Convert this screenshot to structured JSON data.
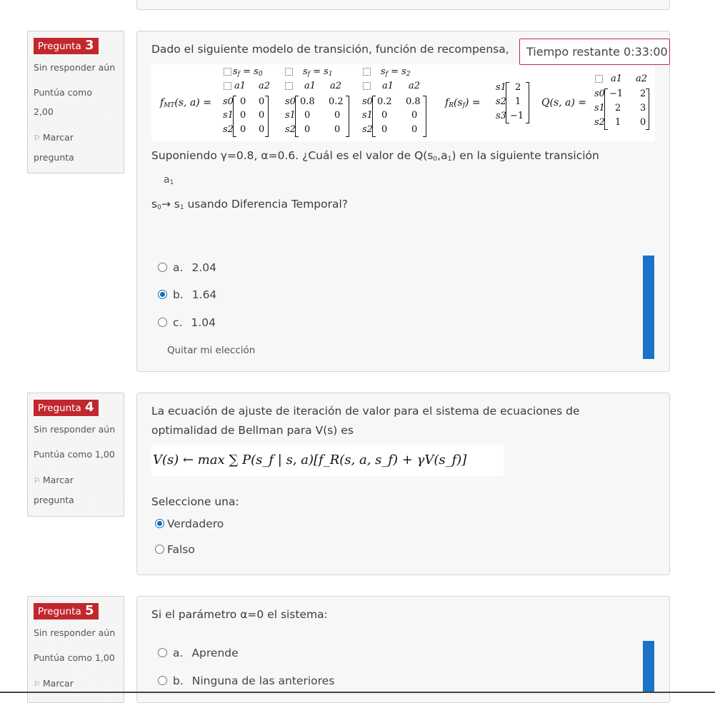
{
  "timer": {
    "label": "Tiempo restante 0:33:00"
  },
  "q3": {
    "badge_word": "Pregunta",
    "badge_num": "3",
    "status": "Sin responder aún",
    "points_line1": "Puntúa como",
    "points_line2": "2,00",
    "flag_line1": "Marcar",
    "flag_line2": "pregunta",
    "text_intro": "Dado el siguiente modelo de transición, función de recompensa,",
    "formula": {
      "fmt_label": "f",
      "fmt_sub": "MT",
      "fmt_args": "(s, a) =",
      "m1": {
        "head": "s",
        "head_sub": "f",
        "head_eq": "= s",
        "head_eq_sub": "0",
        "cols": [
          "a1",
          "a2"
        ],
        "rows": [
          "s0",
          "s1",
          "s2"
        ],
        "vals": [
          [
            "0",
            "0"
          ],
          [
            "0",
            "0"
          ],
          [
            "0",
            "0"
          ]
        ]
      },
      "m2": {
        "head": "s",
        "head_sub": "f",
        "head_eq": "= s",
        "head_eq_sub": "1",
        "cols": [
          "a1",
          "a2"
        ],
        "rows": [
          "s0",
          "s1",
          "s2"
        ],
        "vals": [
          [
            "0.8",
            "0.2"
          ],
          [
            "0",
            "0"
          ],
          [
            "0",
            "0"
          ]
        ]
      },
      "m3": {
        "head": "s",
        "head_sub": "f",
        "head_eq": "= s",
        "head_eq_sub": "2",
        "cols": [
          "a1",
          "a2"
        ],
        "rows": [
          "s0",
          "s1",
          "s2"
        ],
        "vals": [
          [
            "0.2",
            "0.8"
          ],
          [
            "0",
            "0"
          ],
          [
            "0",
            "0"
          ]
        ]
      },
      "fr_label": "f",
      "fr_sub": "R",
      "fr_args": "(s",
      "fr_args_sub": "f",
      "fr_args_end": ") =",
      "r_rows": [
        "s1",
        "s2",
        "s3"
      ],
      "r_vals": [
        "2",
        "1",
        "−1"
      ],
      "q_label": "Q(s, a) =",
      "q_cols": [
        "a1",
        "a2"
      ],
      "q_rows": [
        "s0",
        "s1",
        "s2"
      ],
      "q_vals": [
        [
          "−1",
          "2"
        ],
        [
          "2",
          "3"
        ],
        [
          "1",
          "0"
        ]
      ]
    },
    "text_suppose": "Suponiendo γ=0.8, α=0.6. ¿Cuál es el valor de Q(s",
    "text_suppose_sub0": "0",
    "text_suppose_mid": ",a",
    "text_suppose_sub1": "1",
    "text_suppose_end": ") en la siguiente transición",
    "action_a": "a",
    "action_a_sub": "1",
    "trans_s0": "s",
    "trans_s0_sub": "0",
    "trans_arrow": "→ s",
    "trans_s1_sub": "1",
    "trans_rest": " usando Diferencia Temporal?",
    "options": [
      {
        "letter": "a.",
        "text": "2.04",
        "checked": false
      },
      {
        "letter": "b.",
        "text": "1.64",
        "checked": true
      },
      {
        "letter": "c.",
        "text": "1.04",
        "checked": false
      }
    ],
    "clear_choice": "Quitar mi elección"
  },
  "q4": {
    "badge_word": "Pregunta",
    "badge_num": "4",
    "status": "Sin responder aún",
    "points": "Puntúa como 1,00",
    "flag_line1": "Marcar",
    "flag_line2": "pregunta",
    "text_line1": "La ecuación de ajuste de iteración de valor para el sistema de ecuaciones de",
    "text_line2": "optimalidad de Bellman para V(s) es",
    "equation": "V(s) ← max ∑ P(s_f | s, a)[f_R(s, a, s_f) + γV(s_f)]",
    "select_one": "Seleccione una:",
    "options": [
      {
        "text": "Verdadero",
        "checked": true
      },
      {
        "text": "Falso",
        "checked": false
      }
    ]
  },
  "q5": {
    "badge_word": "Pregunta",
    "badge_num": "5",
    "status": "Sin responder aún",
    "points": "Puntúa como 1,00",
    "flag_line1": "Marcar",
    "text": "Si el parámetro α=0 el sistema:",
    "options": [
      {
        "letter": "a.",
        "text": "Aprende",
        "checked": false
      },
      {
        "letter": "b.",
        "text": "Ninguna de las anteriores",
        "checked": false
      }
    ]
  },
  "colors": {
    "badge_red": "#c1272d",
    "radio_blue": "#0f6cbf",
    "scroll_blue": "#1a73c8",
    "timer_border": "#c1275b"
  },
  "icons": [
    "flag-icon",
    "radio-icon"
  ]
}
